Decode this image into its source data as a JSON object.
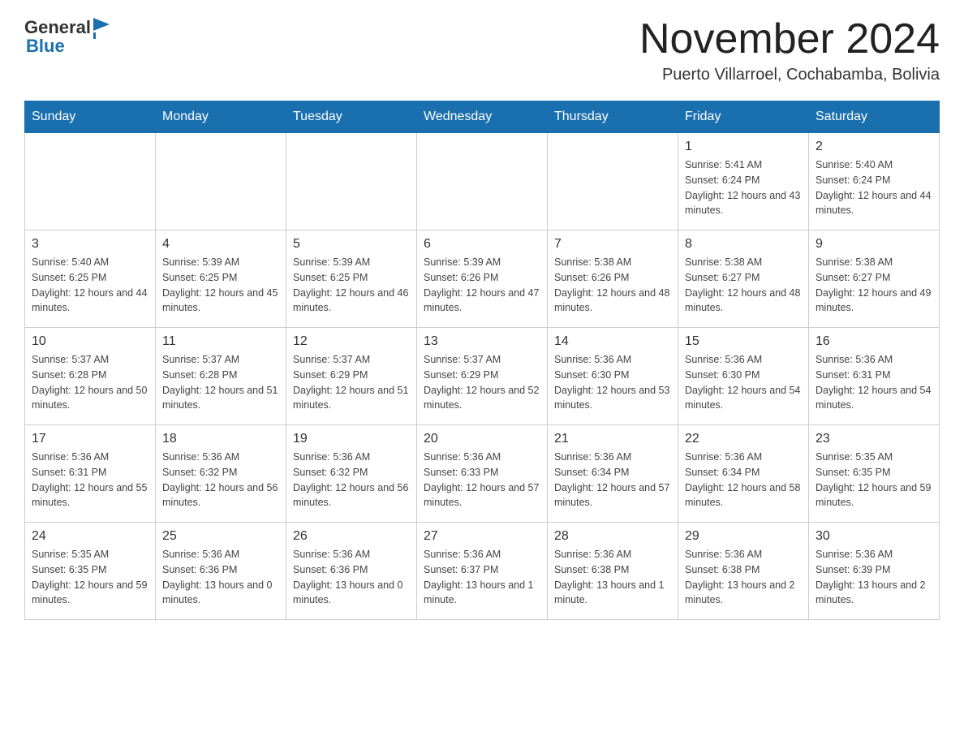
{
  "header": {
    "logo_general": "General",
    "logo_blue": "Blue",
    "month_title": "November 2024",
    "location": "Puerto Villarroel, Cochabamba, Bolivia"
  },
  "weekdays": [
    "Sunday",
    "Monday",
    "Tuesday",
    "Wednesday",
    "Thursday",
    "Friday",
    "Saturday"
  ],
  "weeks": [
    [
      {
        "day": "",
        "info": ""
      },
      {
        "day": "",
        "info": ""
      },
      {
        "day": "",
        "info": ""
      },
      {
        "day": "",
        "info": ""
      },
      {
        "day": "",
        "info": ""
      },
      {
        "day": "1",
        "info": "Sunrise: 5:41 AM\nSunset: 6:24 PM\nDaylight: 12 hours and 43 minutes."
      },
      {
        "day": "2",
        "info": "Sunrise: 5:40 AM\nSunset: 6:24 PM\nDaylight: 12 hours and 44 minutes."
      }
    ],
    [
      {
        "day": "3",
        "info": "Sunrise: 5:40 AM\nSunset: 6:25 PM\nDaylight: 12 hours and 44 minutes."
      },
      {
        "day": "4",
        "info": "Sunrise: 5:39 AM\nSunset: 6:25 PM\nDaylight: 12 hours and 45 minutes."
      },
      {
        "day": "5",
        "info": "Sunrise: 5:39 AM\nSunset: 6:25 PM\nDaylight: 12 hours and 46 minutes."
      },
      {
        "day": "6",
        "info": "Sunrise: 5:39 AM\nSunset: 6:26 PM\nDaylight: 12 hours and 47 minutes."
      },
      {
        "day": "7",
        "info": "Sunrise: 5:38 AM\nSunset: 6:26 PM\nDaylight: 12 hours and 48 minutes."
      },
      {
        "day": "8",
        "info": "Sunrise: 5:38 AM\nSunset: 6:27 PM\nDaylight: 12 hours and 48 minutes."
      },
      {
        "day": "9",
        "info": "Sunrise: 5:38 AM\nSunset: 6:27 PM\nDaylight: 12 hours and 49 minutes."
      }
    ],
    [
      {
        "day": "10",
        "info": "Sunrise: 5:37 AM\nSunset: 6:28 PM\nDaylight: 12 hours and 50 minutes."
      },
      {
        "day": "11",
        "info": "Sunrise: 5:37 AM\nSunset: 6:28 PM\nDaylight: 12 hours and 51 minutes."
      },
      {
        "day": "12",
        "info": "Sunrise: 5:37 AM\nSunset: 6:29 PM\nDaylight: 12 hours and 51 minutes."
      },
      {
        "day": "13",
        "info": "Sunrise: 5:37 AM\nSunset: 6:29 PM\nDaylight: 12 hours and 52 minutes."
      },
      {
        "day": "14",
        "info": "Sunrise: 5:36 AM\nSunset: 6:30 PM\nDaylight: 12 hours and 53 minutes."
      },
      {
        "day": "15",
        "info": "Sunrise: 5:36 AM\nSunset: 6:30 PM\nDaylight: 12 hours and 54 minutes."
      },
      {
        "day": "16",
        "info": "Sunrise: 5:36 AM\nSunset: 6:31 PM\nDaylight: 12 hours and 54 minutes."
      }
    ],
    [
      {
        "day": "17",
        "info": "Sunrise: 5:36 AM\nSunset: 6:31 PM\nDaylight: 12 hours and 55 minutes."
      },
      {
        "day": "18",
        "info": "Sunrise: 5:36 AM\nSunset: 6:32 PM\nDaylight: 12 hours and 56 minutes."
      },
      {
        "day": "19",
        "info": "Sunrise: 5:36 AM\nSunset: 6:32 PM\nDaylight: 12 hours and 56 minutes."
      },
      {
        "day": "20",
        "info": "Sunrise: 5:36 AM\nSunset: 6:33 PM\nDaylight: 12 hours and 57 minutes."
      },
      {
        "day": "21",
        "info": "Sunrise: 5:36 AM\nSunset: 6:34 PM\nDaylight: 12 hours and 57 minutes."
      },
      {
        "day": "22",
        "info": "Sunrise: 5:36 AM\nSunset: 6:34 PM\nDaylight: 12 hours and 58 minutes."
      },
      {
        "day": "23",
        "info": "Sunrise: 5:35 AM\nSunset: 6:35 PM\nDaylight: 12 hours and 59 minutes."
      }
    ],
    [
      {
        "day": "24",
        "info": "Sunrise: 5:35 AM\nSunset: 6:35 PM\nDaylight: 12 hours and 59 minutes."
      },
      {
        "day": "25",
        "info": "Sunrise: 5:36 AM\nSunset: 6:36 PM\nDaylight: 13 hours and 0 minutes."
      },
      {
        "day": "26",
        "info": "Sunrise: 5:36 AM\nSunset: 6:36 PM\nDaylight: 13 hours and 0 minutes."
      },
      {
        "day": "27",
        "info": "Sunrise: 5:36 AM\nSunset: 6:37 PM\nDaylight: 13 hours and 1 minute."
      },
      {
        "day": "28",
        "info": "Sunrise: 5:36 AM\nSunset: 6:38 PM\nDaylight: 13 hours and 1 minute."
      },
      {
        "day": "29",
        "info": "Sunrise: 5:36 AM\nSunset: 6:38 PM\nDaylight: 13 hours and 2 minutes."
      },
      {
        "day": "30",
        "info": "Sunrise: 5:36 AM\nSunset: 6:39 PM\nDaylight: 13 hours and 2 minutes."
      }
    ]
  ]
}
